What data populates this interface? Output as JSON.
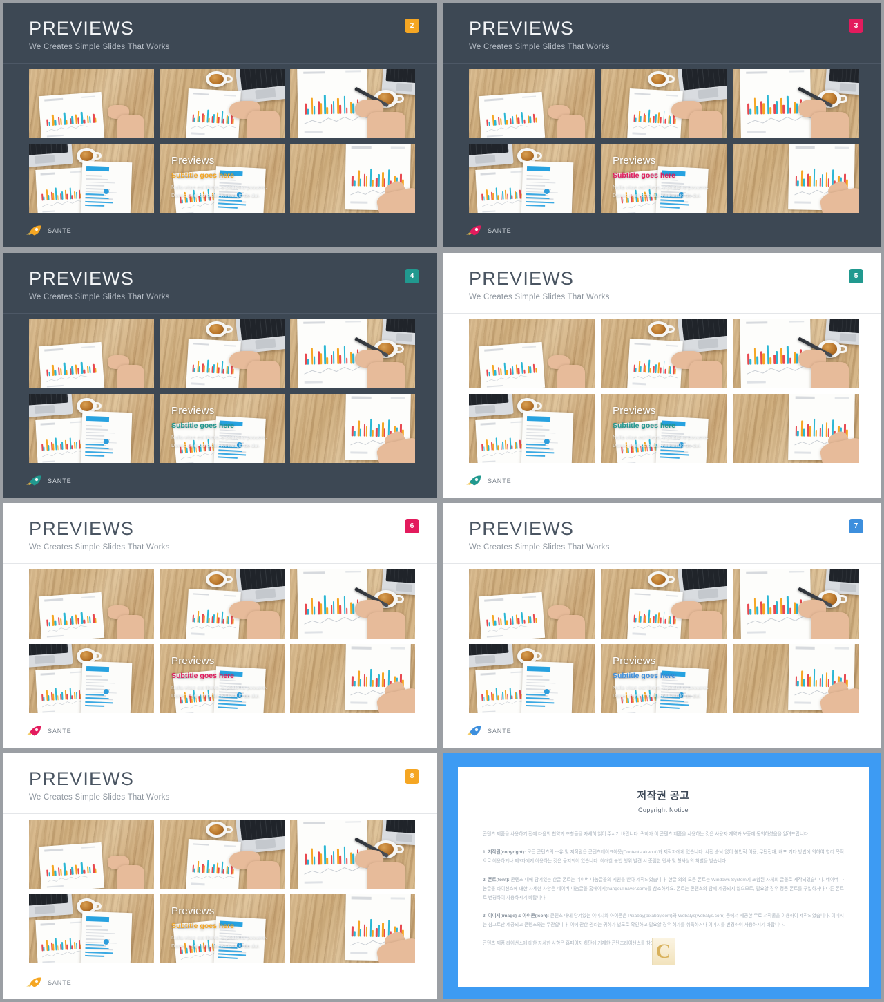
{
  "deck": {
    "slide_title": "PREVIEWS",
    "slide_subtitle": "We Creates Simple Slides That Works",
    "logo_text": "SANTE",
    "overlay": {
      "title": "Previews",
      "subtitle": "Subtitle goes here",
      "body_line1": "Nulla vitae est libero, a pharetra posuere.",
      "body_line2": "Donec eget odio dui. Nullam id do dui."
    },
    "colors": {
      "dark_bg": "#3d4854",
      "light_bg": "#ffffff",
      "gutter": "#9b9fa4",
      "orange": "#f5a623",
      "crimson": "#e31b5d",
      "teal": "#21998f",
      "blue": "#3d8fdd"
    },
    "slides": [
      {
        "number": "2",
        "theme": "dark",
        "badge_color": "#f5a623",
        "accent": "#f5a623"
      },
      {
        "number": "3",
        "theme": "dark",
        "badge_color": "#e31b5d",
        "accent": "#e31b5d"
      },
      {
        "number": "4",
        "theme": "dark",
        "badge_color": "#21998f",
        "accent": "#21998f"
      },
      {
        "number": "5",
        "theme": "light",
        "badge_color": "#21998f",
        "accent": "#21998f"
      },
      {
        "number": "6",
        "theme": "light",
        "badge_color": "#e31b5d",
        "accent": "#e31b5d"
      },
      {
        "number": "7",
        "theme": "light",
        "badge_color": "#3d8fdd",
        "accent": "#3d8fdd"
      },
      {
        "number": "8",
        "theme": "light",
        "badge_color": "#f5a623",
        "accent": "#f5a623"
      }
    ]
  },
  "copyright": {
    "title": "저작권 공고",
    "subtitle": "Copyright Notice",
    "watermark": "C",
    "paragraphs": [
      "콘텐츠 제품을 사용하기 전에 다음의 협약과 조항들을 자세히 읽어 주시기 바랍니다. 귀하가 이 콘텐츠 제품을 사용하는 것은 사용자 계약과 보증에 동의하셨음을 알려드립니다.",
      "1. 저작권(copyright): 모든 콘텐츠의 소유 및 저작권은 콘텐츠테이크아웃(Contentstakeout)과 제작자에게 있습니다. 사전 승낙 없이 불법적 이용, 무단전재, 배포 기타 방법에 의하여 영리 목적으로 이용하거나 제3자에게 이용하는 것은 금지되어 있습니다. 이러한 불법 행위 발견 시 준엄한 민사 및 형사상의 처벌을 받습니다.",
      "2. 폰트(font): 콘텐츠 내에 담겨있는 한글 폰트는 네이버 나눔글꼴의 지원을 받아 제작되었습니다. 한글 외의 모든 폰트는 Windows System에 포함된 자체의 글꼴로 제작되었습니다. 네이버 나눔글꼴 라이선스에 대한 자세한 사항은 네이버 나눔글꼴 홈페이지(hangeul.naver.com)를 참조하세요. 폰트는 콘텐츠와 함께 제공되지 않으므로, 필요할 경우 정품 폰트를 구입하거나 다른 폰트로 변경하여 사용하시기 바랍니다.",
      "3. 이미지(image) & 아이콘(icon): 콘텐츠 내에 담겨있는 이미지와 아이콘은 Pixabay(pixabay.com)와 Webalys(webalys.com) 등에서 제공한 무료 저작물을 이용하여 제작되었습니다. 이미지는 참고로만 제공되고 콘텐츠와는 무관합니다. 이에 관한 권리는 귀하가 별도로 확인하고 필요할 경우 허가를 취득하거나 이미지를 변경하여 사용하시기 바랍니다.",
      "콘텐츠 제품 라이선스에 대한 자세한 사항은 홈페이지 하단에 기재한 콘텐츠라이선스를 참조하세요."
    ]
  }
}
